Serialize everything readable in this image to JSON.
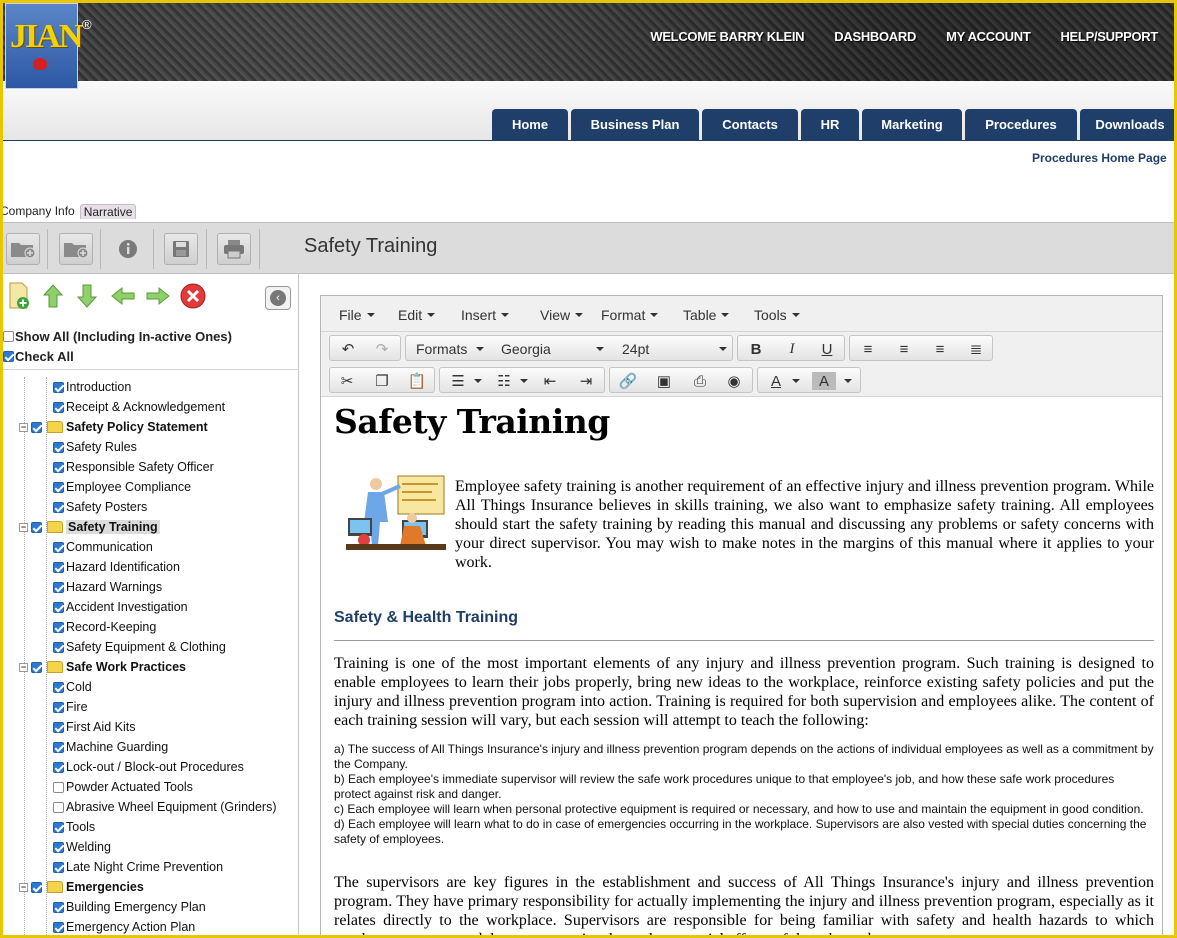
{
  "brand": {
    "logo_text": "JIAN",
    "reg_mark": "®"
  },
  "top_nav": [
    "WELCOME BARRY KLEIN",
    "DASHBOARD",
    "MY ACCOUNT",
    "HELP/SUPPORT"
  ],
  "main_tabs": [
    "Home",
    "Business Plan",
    "Contacts",
    "HR",
    "Marketing",
    "Procedures",
    "Downloads"
  ],
  "breadcrumb": "Procedures Home Page",
  "sub_tabs": {
    "company_info": "Company Info",
    "narrative": "Narrative"
  },
  "page_title": "Safety Training",
  "options": {
    "show_all": "Show All (Including In-active Ones)",
    "check_all": "Check All"
  },
  "tree": [
    {
      "label": "Introduction",
      "level": 2,
      "checked": true
    },
    {
      "label": "Receipt & Acknowledgement",
      "level": 2,
      "checked": true
    },
    {
      "label": "Safety Policy Statement",
      "level": 1,
      "checked": true
    },
    {
      "label": "Safety Rules",
      "level": 2,
      "checked": true
    },
    {
      "label": "Responsible Safety Officer",
      "level": 2,
      "checked": true
    },
    {
      "label": "Employee Compliance",
      "level": 2,
      "checked": true
    },
    {
      "label": "Safety Posters",
      "level": 2,
      "checked": true
    },
    {
      "label": "Safety Training",
      "level": 1,
      "checked": true,
      "selected": true
    },
    {
      "label": "Communication",
      "level": 2,
      "checked": true
    },
    {
      "label": "Hazard Identification",
      "level": 2,
      "checked": true
    },
    {
      "label": "Hazard Warnings",
      "level": 2,
      "checked": true
    },
    {
      "label": "Accident Investigation",
      "level": 2,
      "checked": true
    },
    {
      "label": "Record-Keeping",
      "level": 2,
      "checked": true
    },
    {
      "label": "Safety Equipment & Clothing",
      "level": 2,
      "checked": true
    },
    {
      "label": "Safe Work Practices",
      "level": 1,
      "checked": true
    },
    {
      "label": "Cold",
      "level": 2,
      "checked": true
    },
    {
      "label": "Fire",
      "level": 2,
      "checked": true
    },
    {
      "label": "First Aid Kits",
      "level": 2,
      "checked": true
    },
    {
      "label": "Machine Guarding",
      "level": 2,
      "checked": true
    },
    {
      "label": "Lock-out / Block-out Procedures",
      "level": 2,
      "checked": true
    },
    {
      "label": "Powder Actuated Tools",
      "level": 2,
      "checked": false
    },
    {
      "label": "Abrasive Wheel Equipment (Grinders)",
      "level": 2,
      "checked": false
    },
    {
      "label": "Tools",
      "level": 2,
      "checked": true
    },
    {
      "label": "Welding",
      "level": 2,
      "checked": true
    },
    {
      "label": "Late Night Crime Prevention",
      "level": 2,
      "checked": true
    },
    {
      "label": "Emergencies",
      "level": 1,
      "checked": true
    },
    {
      "label": "Building Emergency Plan",
      "level": 2,
      "checked": true
    },
    {
      "label": "Emergency Action Plan",
      "level": 2,
      "checked": true
    }
  ],
  "editor": {
    "menus": [
      "File",
      "Edit",
      "Insert",
      "View",
      "Format",
      "Table",
      "Tools"
    ],
    "formats_label": "Formats",
    "font_family": "Georgia",
    "font_size": "24pt"
  },
  "doc": {
    "title": "Safety Training",
    "intro": "Employee safety training is another requirement of an effective injury and illness prevention program. While All Things Insurance believes in skills training, we also want to emphasize safety training. All employees should start the safety training by reading this manual and discussing any problems or safety concerns with your direct supervisor. You may wish to make notes in the margins of this manual where it applies to your work.",
    "section_heading": "Safety & Health Training",
    "para2": "Training is one of the most important elements of any injury and illness prevention program. Such training is designed to enable employees to learn their jobs properly, bring new ideas to the workplace, reinforce existing safety policies and put the injury and illness prevention program into action. Training is required for both supervision and employees alike. The content of each training session will vary, but each session will attempt to teach the following:",
    "list": [
      "a) The success of All Things Insurance's injury and illness prevention program depends on the actions of individual employees as well as a commitment by the Company.",
      "b) Each employee's immediate supervisor will review the safe work procedures unique to that employee's job, and how these safe work procedures protect against risk and danger.",
      "c) Each employee will learn when personal protective equipment is required or necessary, and how to use and maintain the equipment in good condition.",
      "d) Each employee will learn what to do in case of emergencies occurring in the workplace. Supervisors are also vested with special duties concerning the safety of employees."
    ],
    "para3": "The supervisors are key figures in the establishment and success of All Things Insurance's injury and illness prevention program. They have primary responsibility for actually implementing the injury and illness prevention program, especially as it relates directly to the workplace. Supervisors are responsible for being familiar with safety and health hazards to which employees are exposed, how to recognize them, the potential effects of these hazards"
  },
  "colors": {
    "nav_blue": "#1f3f6a",
    "frame_yellow": "#e8c700",
    "check_blue": "#2d7ad6"
  }
}
